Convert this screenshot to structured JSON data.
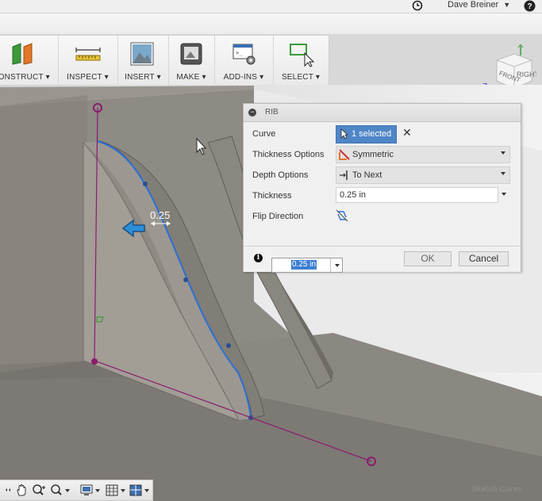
{
  "header": {
    "user_name": "Dave Breiner",
    "user_menu_icon": "caret-down-icon",
    "clock_icon": "clock-icon",
    "help_icon": "help-icon"
  },
  "toolbar": {
    "groups": [
      {
        "label": "CONSTRUCT ▾",
        "icon": "construct-plane-icon"
      },
      {
        "label": "INSPECT ▾",
        "icon": "measure-ruler-icon"
      },
      {
        "label": "INSERT ▾",
        "icon": "insert-image-icon"
      },
      {
        "label": "MAKE ▾",
        "icon": "make-3dprint-icon"
      },
      {
        "label": "ADD-INS ▾",
        "icon": "addins-script-icon"
      },
      {
        "label": "SELECT ▾",
        "icon": "select-cursor-icon"
      }
    ]
  },
  "viewcube": {
    "face_front": "FRONT",
    "face_right": "RIGHT",
    "axis_z": "Z"
  },
  "dialog": {
    "title": "RIB",
    "rows": {
      "curve": {
        "label": "Curve",
        "value": "1 selected"
      },
      "thickness_options": {
        "label": "Thickness Options",
        "value": "Symmetric"
      },
      "depth_options": {
        "label": "Depth Options",
        "value": "To Next"
      },
      "thickness": {
        "label": "Thickness",
        "value": "0.25 in"
      },
      "flip_direction": {
        "label": "Flip Direction"
      }
    },
    "ok_label": "OK",
    "cancel_label": "Cancel"
  },
  "canvas": {
    "dimension_label": "0.25",
    "input_value": "0.25 in"
  },
  "status": {
    "text": "Sketch Curve"
  },
  "colors": {
    "accent": "#4f86c6",
    "profile_curve": "#2a6fd6",
    "sketch_line": "#8a1c6e"
  }
}
